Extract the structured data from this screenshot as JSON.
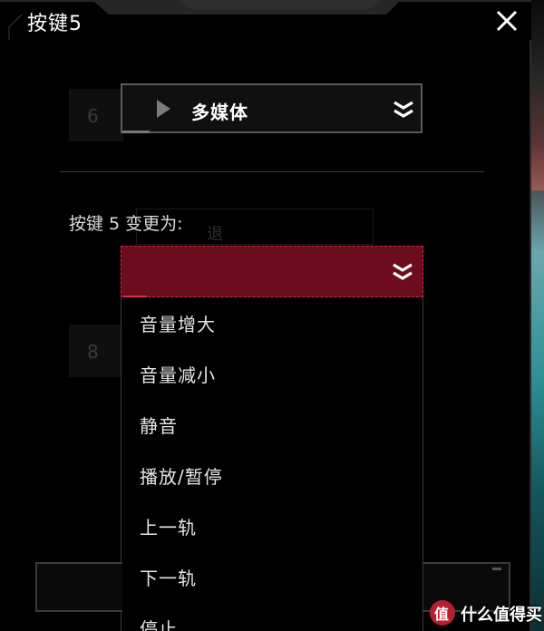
{
  "window": {
    "title": "按键5",
    "close_icon": "close-icon"
  },
  "background_rows": {
    "row_6": "6",
    "row_back": "退",
    "row_8": "8"
  },
  "category_select": {
    "icon": "play-icon",
    "value": "多媒体",
    "chevron": "double-chevron-down-icon"
  },
  "change_label": "按键 5 变更为:",
  "action_select": {
    "value": "",
    "chevron": "double-chevron-down-icon",
    "highlight_color": "#6b0d1c"
  },
  "dropdown": {
    "options": [
      "音量增大",
      "音量减小",
      "静音",
      "播放/暂停",
      "上一轨",
      "下一轨",
      "停止"
    ]
  },
  "watermark": {
    "logo_text": "值",
    "text": "什么值得买"
  }
}
